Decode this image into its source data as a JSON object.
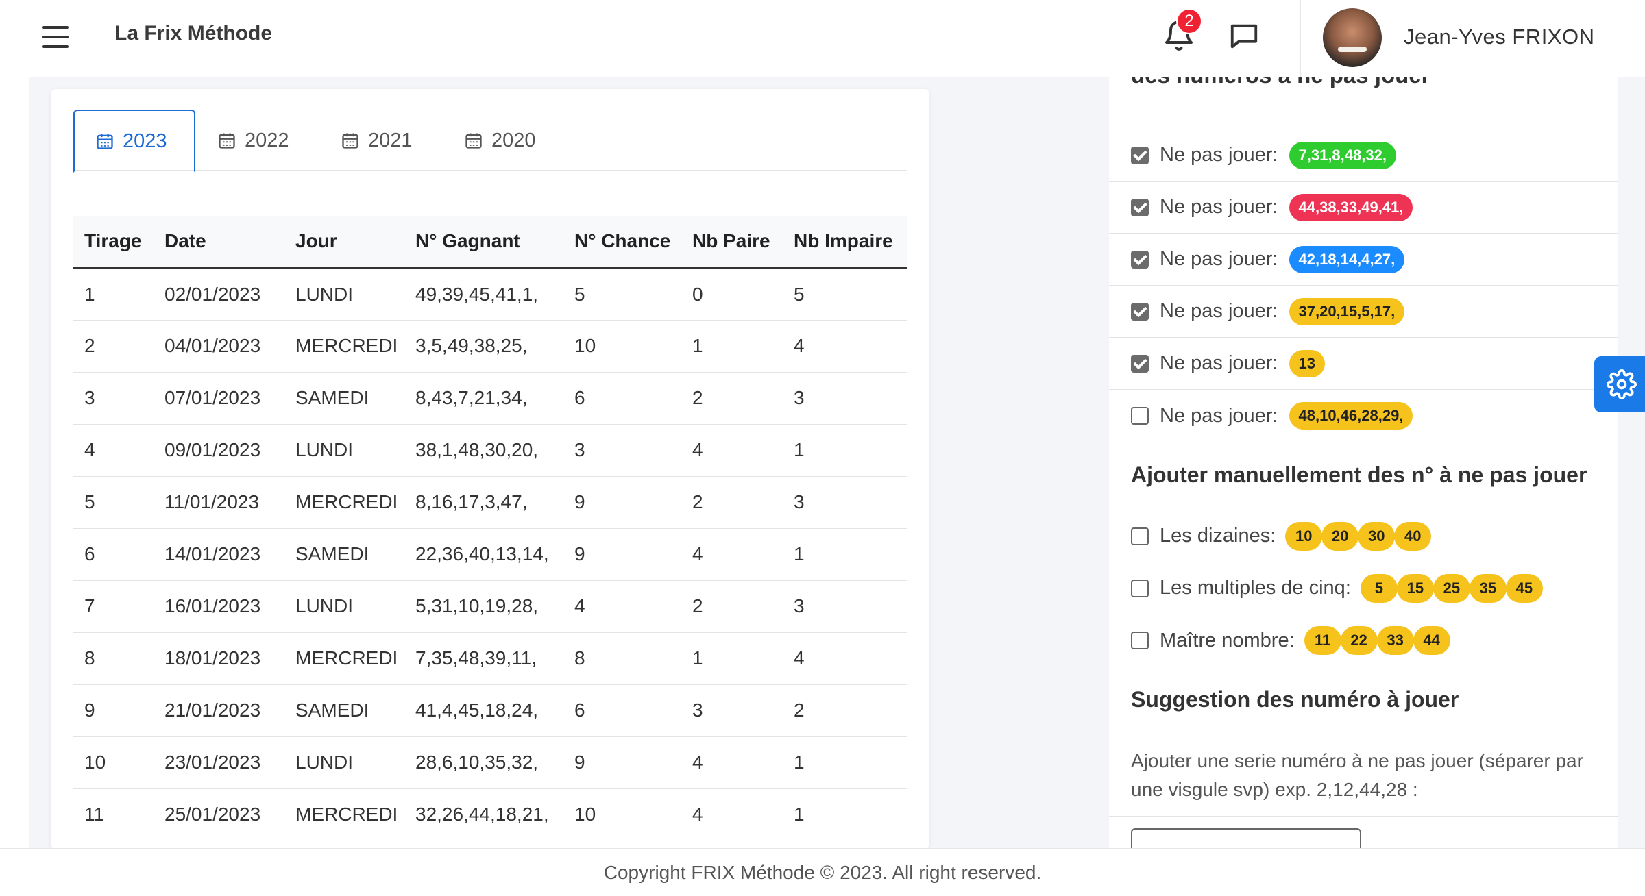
{
  "header": {
    "brand": "La Frix Méthode",
    "notification_count": "2",
    "user_name": "Jean-Yves FRIXON"
  },
  "tabs": [
    {
      "label": "2023",
      "active": true
    },
    {
      "label": "2022",
      "active": false
    },
    {
      "label": "2021",
      "active": false
    },
    {
      "label": "2020",
      "active": false
    }
  ],
  "table": {
    "columns": [
      "Tirage",
      "Date",
      "Jour",
      "N° Gagnant",
      "N° Chance",
      "Nb Paire",
      "Nb Impaire"
    ],
    "rows": [
      [
        "1",
        "02/01/2023",
        "LUNDI",
        "49,39,45,41,1,",
        "5",
        "0",
        "5"
      ],
      [
        "2",
        "04/01/2023",
        "MERCREDI",
        "3,5,49,38,25,",
        "10",
        "1",
        "4"
      ],
      [
        "3",
        "07/01/2023",
        "SAMEDI",
        "8,43,7,21,34,",
        "6",
        "2",
        "3"
      ],
      [
        "4",
        "09/01/2023",
        "LUNDI",
        "38,1,48,30,20,",
        "3",
        "4",
        "1"
      ],
      [
        "5",
        "11/01/2023",
        "MERCREDI",
        "8,16,17,3,47,",
        "9",
        "2",
        "3"
      ],
      [
        "6",
        "14/01/2023",
        "SAMEDI",
        "22,36,40,13,14,",
        "9",
        "4",
        "1"
      ],
      [
        "7",
        "16/01/2023",
        "LUNDI",
        "5,31,10,19,28,",
        "4",
        "2",
        "3"
      ],
      [
        "8",
        "18/01/2023",
        "MERCREDI",
        "7,35,48,39,11,",
        "8",
        "1",
        "4"
      ],
      [
        "9",
        "21/01/2023",
        "SAMEDI",
        "41,4,45,18,24,",
        "6",
        "3",
        "2"
      ],
      [
        "10",
        "23/01/2023",
        "LUNDI",
        "28,6,10,35,32,",
        "9",
        "4",
        "1"
      ],
      [
        "11",
        "25/01/2023",
        "MERCREDI",
        "32,26,44,18,21,",
        "10",
        "4",
        "1"
      ]
    ]
  },
  "panel": {
    "cut_heading": "des numéros à ne pas jouer",
    "exclude_items": [
      {
        "label": "Ne pas jouer:",
        "numbers": "7,31,8,48,32,",
        "color": "green",
        "checked": true
      },
      {
        "label": "Ne pas jouer:",
        "numbers": "44,38,33,49,41,",
        "color": "red",
        "checked": true
      },
      {
        "label": "Ne pas jouer:",
        "numbers": "42,18,14,4,27,",
        "color": "blue",
        "checked": true
      },
      {
        "label": "Ne pas jouer:",
        "numbers": "37,20,15,5,17,",
        "color": "yellow",
        "checked": true
      },
      {
        "label": "Ne pas jouer:",
        "numbers": "13",
        "color": "yellow",
        "checked": true
      },
      {
        "label": "Ne pas jouer:",
        "numbers": "48,10,46,28,29,",
        "color": "yellow",
        "checked": false
      }
    ],
    "manual_title": "Ajouter manuellement des n° à ne pas jouer",
    "manual_items": [
      {
        "label": "Les dizaines:",
        "balls": [
          "10",
          "20",
          "30",
          "40"
        ],
        "checked": false
      },
      {
        "label": "Les multiples de cinq:",
        "balls": [
          "5",
          "15",
          "25",
          "35",
          "45"
        ],
        "checked": false
      },
      {
        "label": "Maître nombre:",
        "balls": [
          "11",
          "22",
          "33",
          "44"
        ],
        "checked": false
      }
    ],
    "suggest_title": "Suggestion des numéro à jouer",
    "suggest_desc": "Ajouter une serie numéro à ne pas jouer (séparer par une visgule svp) exp. 2,12,44,28 :",
    "input_value": ""
  },
  "footer": {
    "copyright": "Copyright FRIX Méthode © 2023. All right reserved."
  },
  "colors": {
    "primary": "#1e6bd6",
    "green": "#2ecc2e",
    "red": "#ee3355",
    "blue": "#1a8cff",
    "yellow": "#f6c21c"
  }
}
